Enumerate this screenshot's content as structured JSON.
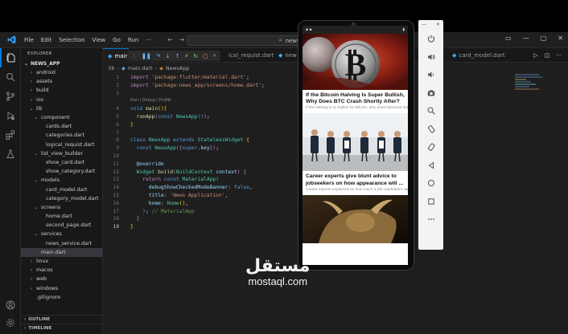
{
  "titlebar": {
    "menu": [
      "File",
      "Edit",
      "Selection",
      "View",
      "Go",
      "Run",
      "···"
    ],
    "search": "news_app"
  },
  "explorer": {
    "title": "EXPLORER",
    "root": "NEWS_APP",
    "items": [
      {
        "label": "android",
        "depth": 1,
        "chevron": "›"
      },
      {
        "label": "assets",
        "depth": 1,
        "chevron": "›"
      },
      {
        "label": "build",
        "depth": 1,
        "chevron": "›"
      },
      {
        "label": "ios",
        "depth": 1,
        "chevron": "›"
      },
      {
        "label": "lib",
        "depth": 1,
        "chevron": "⌄"
      },
      {
        "label": "component",
        "depth": 2,
        "chevron": "⌄"
      },
      {
        "label": "cards.dart",
        "depth": 3,
        "chevron": ""
      },
      {
        "label": "categories.dart",
        "depth": 3,
        "chevron": ""
      },
      {
        "label": "logical_requist.dart",
        "depth": 3,
        "chevron": ""
      },
      {
        "label": "list_view_builder",
        "depth": 2,
        "chevron": "⌄"
      },
      {
        "label": "show_card.dart",
        "depth": 3,
        "chevron": ""
      },
      {
        "label": "show_category.dart",
        "depth": 3,
        "chevron": ""
      },
      {
        "label": "models",
        "depth": 2,
        "chevron": "⌄"
      },
      {
        "label": "card_model.dart",
        "depth": 3,
        "chevron": ""
      },
      {
        "label": "category_model.dart",
        "depth": 3,
        "chevron": ""
      },
      {
        "label": "screens",
        "depth": 2,
        "chevron": "⌄"
      },
      {
        "label": "home.dart",
        "depth": 3,
        "chevron": ""
      },
      {
        "label": "second_page.dart",
        "depth": 3,
        "chevron": ""
      },
      {
        "label": "services",
        "depth": 2,
        "chevron": "⌄"
      },
      {
        "label": "news_service.dart",
        "depth": 3,
        "chevron": ""
      },
      {
        "label": "main.dart",
        "depth": 2,
        "chevron": "",
        "active": true
      },
      {
        "label": "linux",
        "depth": 1,
        "chevron": "›"
      },
      {
        "label": "macos",
        "depth": 1,
        "chevron": "›"
      },
      {
        "label": "web",
        "depth": 1,
        "chevron": "›"
      },
      {
        "label": "windows",
        "depth": 1,
        "chevron": "›"
      },
      {
        "label": ".gitignore",
        "depth": 1,
        "chevron": ""
      }
    ],
    "outline": "OUTLINE",
    "timeline": "TIMELINE"
  },
  "tabs": [
    {
      "label": "main.d",
      "active": true
    },
    {
      "label": "ical_requist.dart",
      "active": false
    },
    {
      "label": "new",
      "active": false
    },
    {
      "label": "card_model.dart",
      "active": false
    }
  ],
  "breadcrumb": [
    "lib",
    "main.dart",
    "NewsApp"
  ],
  "code": {
    "line_numbers": [
      "1",
      "2",
      "3",
      "",
      "4",
      "5",
      "6",
      "7",
      "8",
      "9",
      "10",
      "11",
      "12",
      "13",
      "14",
      "15",
      "16",
      "17",
      "18",
      "19"
    ],
    "current_line": "19",
    "codelens": "Run | Debug | Profile"
  },
  "emulator": {
    "window_ctrls": [
      "—",
      "×"
    ],
    "articles": [
      {
        "headline": "If the Bitcoin Halving Is Super Bullish, Why Does BTC Crash Shortly After?",
        "description": "If the halving is so bullish for Bitcoin, why does historical data show BTC crashes within a year..."
      },
      {
        "headline": "Career experts give blunt advice to jobseekers on how appearance will ...",
        "description": "Career experts explained on how much a job candidate's appearance can affect their interv..."
      }
    ]
  },
  "watermark": {
    "arabic": "مستقل",
    "latin": "mostaql.com"
  }
}
